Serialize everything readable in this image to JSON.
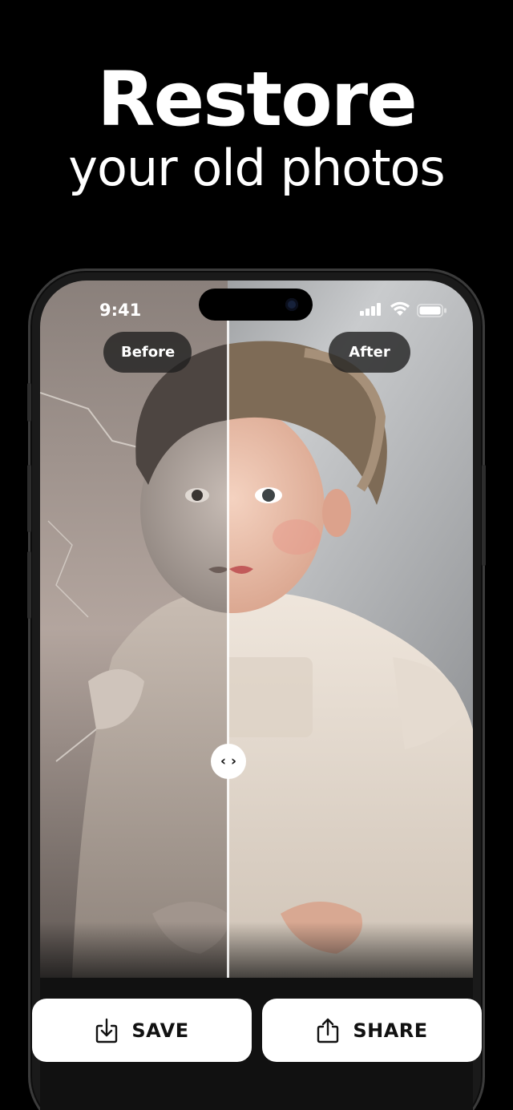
{
  "headline": {
    "line1": "Restore",
    "line2": "your old photos"
  },
  "status_bar": {
    "time": "9:41",
    "icons": [
      "signal-icon",
      "wifi-icon",
      "battery-icon"
    ]
  },
  "comparison": {
    "before_label": "Before",
    "after_label": "After",
    "slider_glyph": "‹ ›",
    "split_fraction": 0.43
  },
  "actions": {
    "save_label": "SAVE",
    "save_icon": "download-icon",
    "share_label": "SHARE",
    "share_icon": "share-icon"
  },
  "colors": {
    "background": "#000000",
    "button_bg": "#ffffff",
    "button_text": "#111111",
    "pill_bg": "#1e1e1e"
  }
}
